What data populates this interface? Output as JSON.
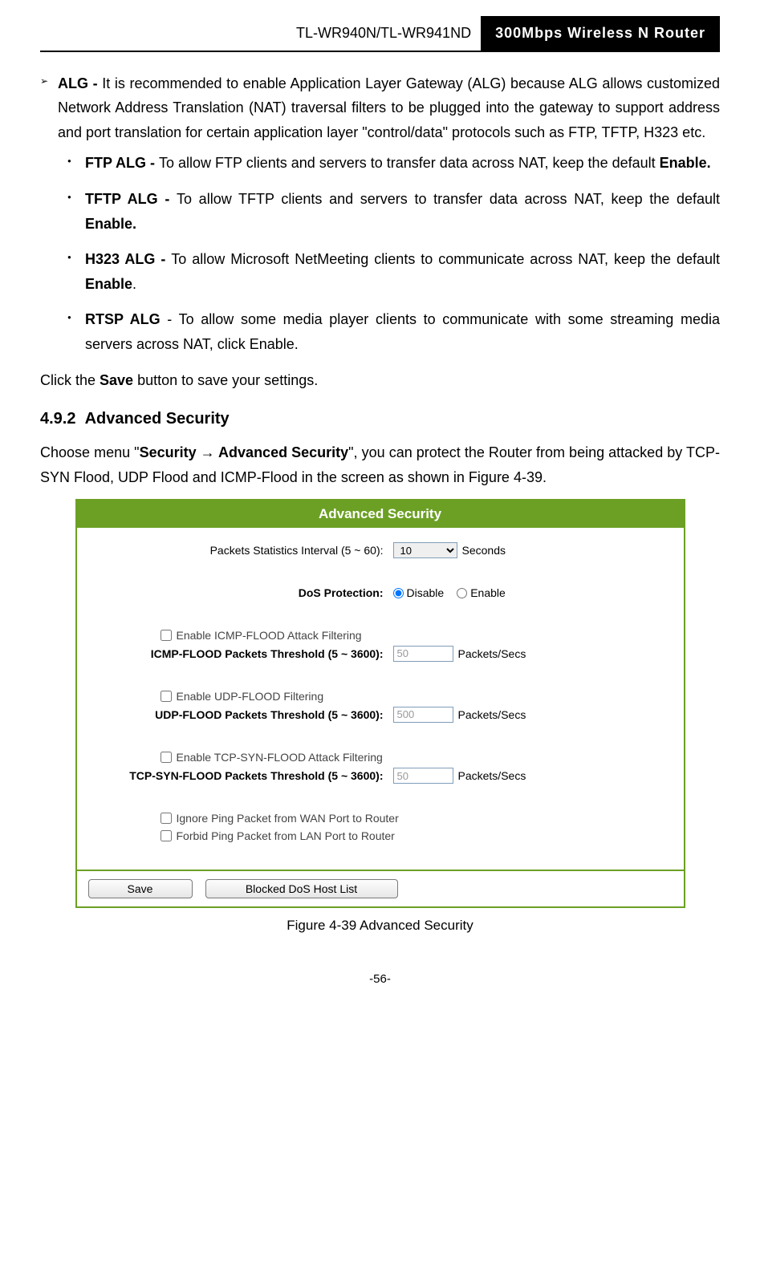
{
  "header": {
    "left": "TL-WR940N/TL-WR941ND",
    "right": "300Mbps Wireless N Router"
  },
  "alg": {
    "title": "ALG - ",
    "body": "It is recommended to enable Application Layer Gateway (ALG) because ALG allows customized Network Address Translation (NAT) traversal filters to be plugged into the gateway to support address and port translation for certain application layer \"control/data\" protocols such as FTP, TFTP, H323 etc.",
    "items": [
      {
        "title": "FTP ALG - ",
        "body_pre": "To allow FTP clients and servers to transfer data across NAT, keep the default ",
        "bold": "Enable.",
        "body_post": ""
      },
      {
        "title": "TFTP ALG - ",
        "body_pre": "To allow TFTP clients and servers to transfer data across NAT, keep the default ",
        "bold": "Enable.",
        "body_post": ""
      },
      {
        "title": "H323 ALG - ",
        "body_pre": "To allow Microsoft NetMeeting clients to communicate across NAT, keep the default ",
        "bold": "Enable",
        "body_post": "."
      },
      {
        "title": "RTSP ALG",
        "body_pre": " - To allow some media player clients to communicate with some streaming media servers across NAT, click Enable.",
        "bold": "",
        "body_post": ""
      }
    ]
  },
  "save_line": {
    "pre": "Click the ",
    "bold": "Save",
    "post": " button to save your settings."
  },
  "section": {
    "num": "4.9.2",
    "title": "Advanced Security"
  },
  "intro": {
    "pre": "Choose menu \"",
    "bold1": "Security → Advanced Security",
    "mid": "\", you can protect the Router from being attacked by TCP-SYN Flood, UDP Flood and ICMP-Flood in the screen as shown in ",
    "post": "Figure 4-39."
  },
  "panel": {
    "title": "Advanced Security",
    "stats_label": "Packets Statistics Interval (5 ~ 60):",
    "stats_value": "10",
    "stats_unit": "Seconds",
    "dos_label": "DoS Protection:",
    "dos_disable": "Disable",
    "dos_enable": "Enable",
    "icmp_check": "Enable ICMP-FLOOD Attack Filtering",
    "icmp_label": "ICMP-FLOOD Packets Threshold (5 ~ 3600):",
    "icmp_value": "50",
    "udp_check": "Enable UDP-FLOOD Filtering",
    "udp_label": "UDP-FLOOD Packets Threshold (5 ~ 3600):",
    "udp_value": "500",
    "tcp_check": "Enable TCP-SYN-FLOOD Attack Filtering",
    "tcp_label": "TCP-SYN-FLOOD Packets Threshold (5 ~ 3600):",
    "tcp_value": "50",
    "unit": "Packets/Secs",
    "ignore_wan": "Ignore Ping Packet from WAN Port to Router",
    "forbid_lan": "Forbid Ping Packet from LAN Port to Router",
    "btn_save": "Save",
    "btn_blocked": "Blocked DoS Host List"
  },
  "caption": "Figure 4-39  Advanced Security",
  "page_num": "-56-"
}
